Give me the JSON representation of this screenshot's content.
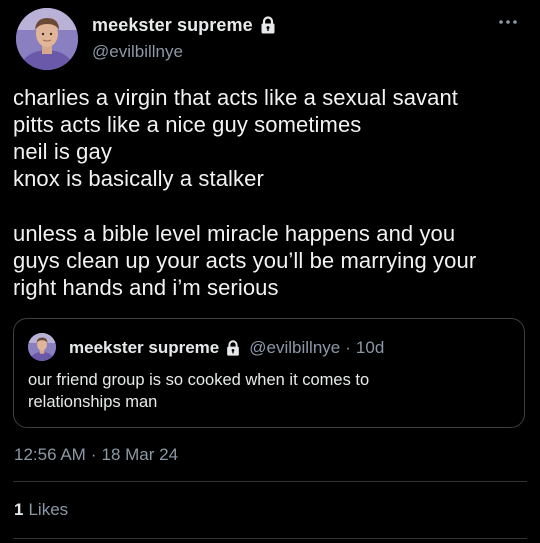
{
  "author": {
    "display_name": "meekster supreme",
    "handle": "@evilbillnye",
    "avatar_icon": "profile-photo",
    "protected_icon": "lock-icon"
  },
  "menu": {
    "more_icon": "more-options-icon"
  },
  "tweet": {
    "lines": [
      "charlies a virgin that acts like a sexual savant",
      "pitts acts like a nice guy sometimes",
      "neil is gay",
      "knox is basically a stalker"
    ],
    "lines2": [
      "unless a bible level miracle happens and you",
      "guys clean up your acts you’ll be marrying your",
      "right hands and i’m serious"
    ]
  },
  "quoted_tweet": {
    "display_name": "meekster supreme",
    "handle": "@evilbillnye",
    "separator": "·",
    "relative_time": "10d",
    "lines": [
      "our friend group is so cooked when it comes to",
      "relationships man"
    ]
  },
  "meta": {
    "time": "12:56 AM",
    "separator": "·",
    "date": "18 Mar 24"
  },
  "stats": {
    "likes_count": "1",
    "likes_label": "Likes"
  },
  "colors": {
    "background": "#000000",
    "primary_text": "#e7e9ea",
    "secondary_text": "#8b98a5",
    "border": "#2f3336"
  }
}
